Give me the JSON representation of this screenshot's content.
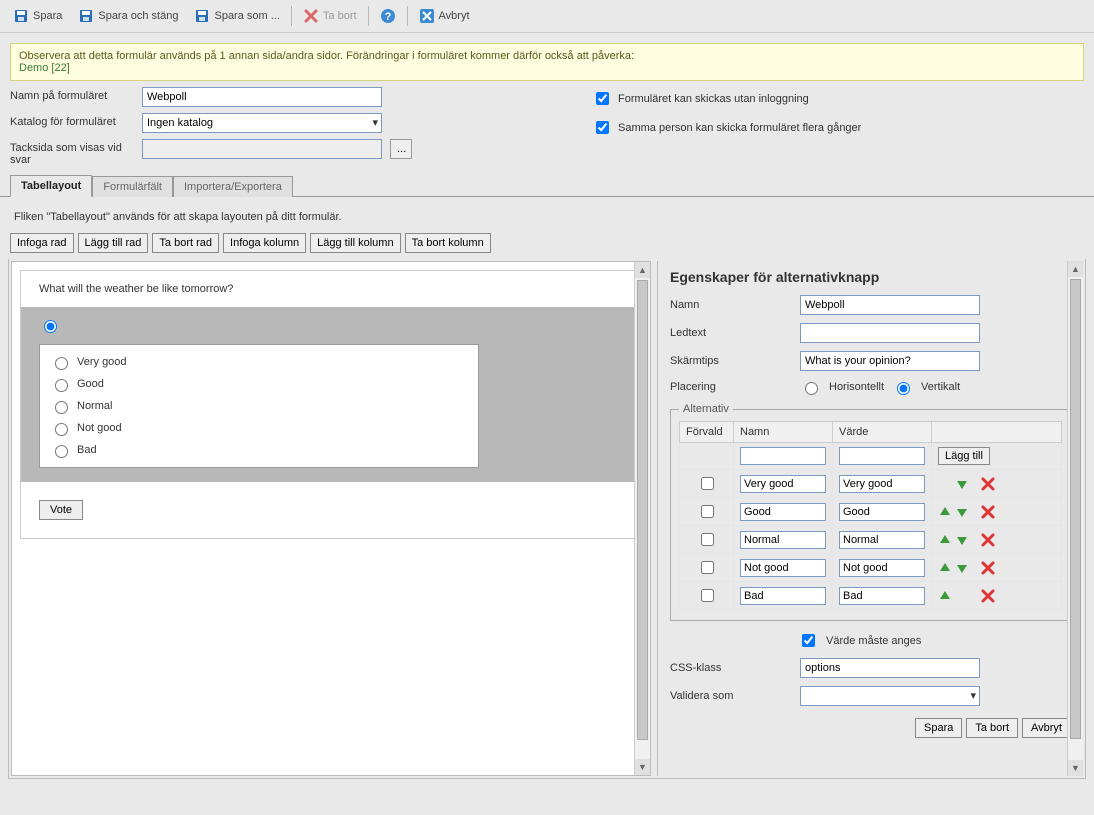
{
  "toolbar": {
    "save": "Spara",
    "save_close": "Spara och stäng",
    "save_as": "Spara som ...",
    "delete": "Ta bort",
    "help": "",
    "cancel": "Avbryt"
  },
  "notice": {
    "line1": "Observera att detta formulär används på 1 annan sida/andra sidor. Förändringar i formuläret kommer därför också att påverka:",
    "link": "Demo [22]"
  },
  "form": {
    "name_label": "Namn på formuläret",
    "name_value": "Webpoll",
    "catalog_label": "Katalog för formuläret",
    "catalog_value": "Ingen katalog",
    "thanks_label": "Tacksida som visas vid svar",
    "thanks_value": "",
    "browse": "...",
    "chk1": "Formuläret kan skickas utan inloggning",
    "chk1_checked": true,
    "chk2": "Samma person kan skicka formuläret flera gånger",
    "chk2_checked": true
  },
  "tabs": {
    "tab1": "Tabellayout",
    "tab2": "Formulärfält",
    "tab3": "Importera/Exportera"
  },
  "hint": "Fliken \"Tabellayout\" används för att skapa layouten på ditt formulär.",
  "row_btns": {
    "insert_row": "Infoga rad",
    "add_row": "Lägg till rad",
    "delete_row": "Ta bort rad",
    "insert_col": "Infoga kolumn",
    "add_col": "Lägg till kolumn",
    "delete_col": "Ta bort kolumn"
  },
  "preview": {
    "question": "What will the weather be like tomorrow?",
    "options": [
      "Very good",
      "Good",
      "Normal",
      "Not good",
      "Bad"
    ],
    "vote": "Vote"
  },
  "props": {
    "title": "Egenskaper för alternativknapp",
    "name_label": "Namn",
    "name_value": "Webpoll",
    "caption_label": "Ledtext",
    "caption_value": "",
    "tooltip_label": "Skärmtips",
    "tooltip_value": "What is your opinion?",
    "placement_label": "Placering",
    "placement_h": "Horisontellt",
    "placement_v": "Vertikalt",
    "alt_legend": "Alternativ",
    "col_default": "Förvald",
    "col_name": "Namn",
    "col_value": "Värde",
    "add_btn": "Lägg till",
    "rows": [
      {
        "name": "Very good",
        "value": "Very good",
        "up": false,
        "down": true
      },
      {
        "name": "Good",
        "value": "Good",
        "up": true,
        "down": true
      },
      {
        "name": "Normal",
        "value": "Normal",
        "up": true,
        "down": true
      },
      {
        "name": "Not good",
        "value": "Not good",
        "up": true,
        "down": true
      },
      {
        "name": "Bad",
        "value": "Bad",
        "up": true,
        "down": false
      }
    ],
    "required_label": "Värde måste anges",
    "required_checked": true,
    "css_label": "CSS-klass",
    "css_value": "options",
    "validate_label": "Validera som",
    "validate_value": "",
    "save": "Spara",
    "delete": "Ta bort",
    "cancel": "Avbryt"
  }
}
